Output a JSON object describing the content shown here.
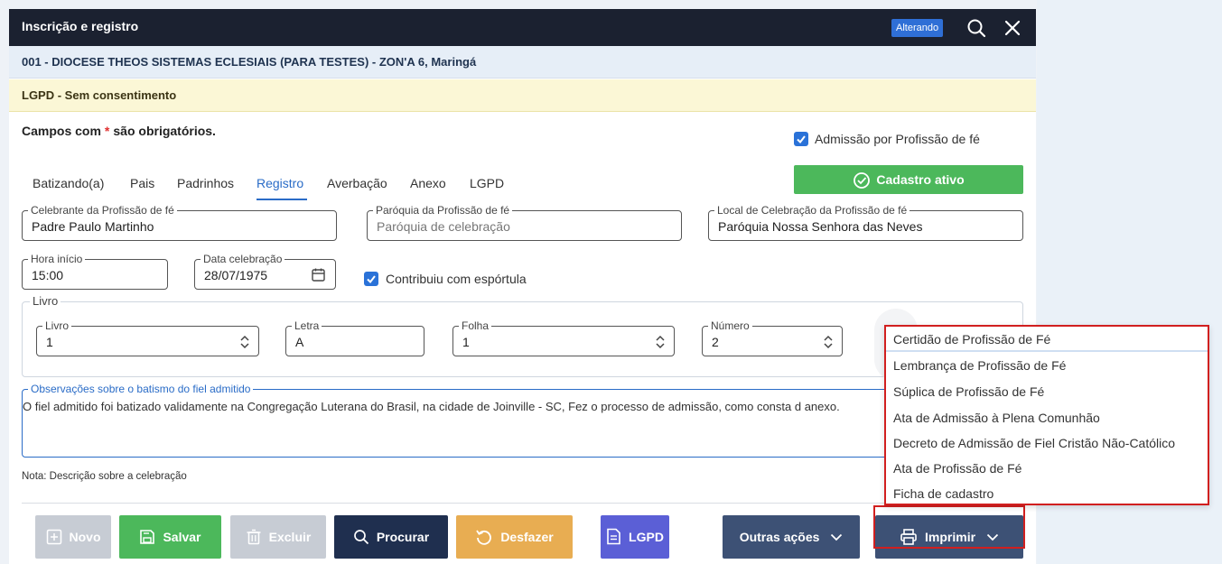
{
  "window": {
    "title": "Inscrição e registro",
    "mode_badge": "Alterando",
    "parish_line": "001 - DIOCESE THEOS SISTEMAS ECLESIAIS (PARA TESTES) - ZON'A 6, Maringá",
    "lgpd_status": "LGPD - Sem consentimento"
  },
  "form": {
    "required_prefix": "Campos com",
    "required_star": "*",
    "required_suffix": "são obrigatórios.",
    "admission_checkbox": {
      "label": "Admissão por Profissão de fé",
      "checked": true
    },
    "tabs": [
      {
        "label": "Batizando(a)"
      },
      {
        "label": "Pais"
      },
      {
        "label": "Padrinhos"
      },
      {
        "label": "Registro",
        "active": true
      },
      {
        "label": "Averbação"
      },
      {
        "label": "Anexo"
      },
      {
        "label": "LGPD"
      }
    ],
    "status_button": "Cadastro ativo",
    "celebrante": {
      "label": "Celebrante da Profissão de fé",
      "value": "Padre Paulo Martinho"
    },
    "paroquia": {
      "label": "Paróquia da Profissão de fé",
      "placeholder": "Paróquia de celebração"
    },
    "local": {
      "label": "Local de Celebração da Profissão de fé",
      "value": "Paróquia Nossa Senhora das Neves"
    },
    "hora": {
      "label": "Hora início",
      "value": "15:00"
    },
    "data": {
      "label": "Data celebração",
      "value": "28/07/1975"
    },
    "espórtula": {
      "label": "Contribuiu com espórtula",
      "checked": true
    },
    "livro_group": {
      "label": "Livro",
      "livro": {
        "label": "Livro",
        "value": "1"
      },
      "letra": {
        "label": "Letra",
        "value": "A"
      },
      "folha": {
        "label": "Folha",
        "value": "1"
      },
      "numero": {
        "label": "Número",
        "value": "2"
      }
    },
    "observacoes": {
      "label": "Observações sobre o batismo do fiel admitido",
      "value": "O fiel admitido foi batizado validamente na Congregação Luterana do Brasil, na cidade de Joinville - SC, Fez o processo de admissão, como consta d anexo."
    },
    "nota": "Nota: Descrição sobre a celebração"
  },
  "actions": {
    "novo": "Novo",
    "salvar": "Salvar",
    "excluir": "Excluir",
    "procurar": "Procurar",
    "desfazer": "Desfazer",
    "lgpd": "LGPD",
    "outras": "Outras ações",
    "imprimir": "Imprimir"
  },
  "print_menu": [
    "Certidão de Profissão de Fé",
    "Lembrança de Profissão de Fé",
    "Súplica de Profissão de Fé",
    "Ata de Admissão à Plena Comunhão",
    "Decreto de Admissão de Fiel Cristão Não-Católico",
    "Ata de Profissão de Fé",
    "Ficha de cadastro"
  ],
  "colors": {
    "titlebar": "#1b2130",
    "accent_blue": "#2a6cc7",
    "green": "#4cb85b",
    "navy": "#1f2f4f",
    "orange": "#e8ad52",
    "purple": "#5b5fd6",
    "slate": "#3d5175",
    "disabled": "#c7ccd4",
    "highlight_red": "#d11f1f"
  },
  "icons": [
    "search-icon",
    "close-icon",
    "check-icon",
    "circle-check-icon",
    "calendar-icon",
    "spinner-icon",
    "plus-icon",
    "save-icon",
    "trash-icon",
    "undo-icon",
    "document-icon",
    "chevron-down-icon",
    "printer-icon"
  ]
}
